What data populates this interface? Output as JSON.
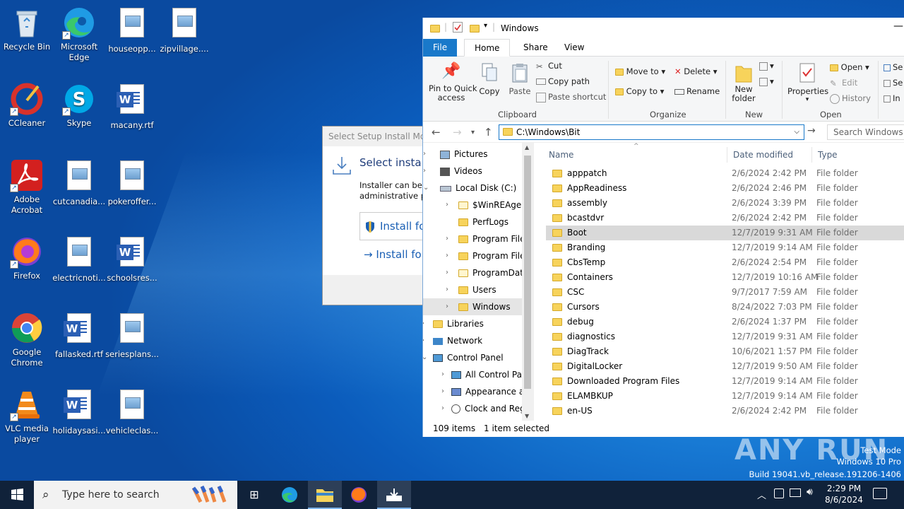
{
  "desktop": {
    "icons": [
      {
        "label": "Recycle Bin"
      },
      {
        "label": "Microsoft Edge"
      },
      {
        "label": "houseopp..."
      },
      {
        "label": "zipvillage...."
      },
      {
        "label": "CCleaner"
      },
      {
        "label": "Skype"
      },
      {
        "label": "macany.rtf"
      },
      {
        "label": "Adobe Acrobat"
      },
      {
        "label": "cutcanadia..."
      },
      {
        "label": "pokeroffer..."
      },
      {
        "label": "Firefox"
      },
      {
        "label": "electricnoti..."
      },
      {
        "label": "schoolsres..."
      },
      {
        "label": "Google Chrome"
      },
      {
        "label": "fallasked.rtf"
      },
      {
        "label": "seriesplans..."
      },
      {
        "label": "VLC media player"
      },
      {
        "label": "holidaysasi..."
      },
      {
        "label": "vehicleclas..."
      }
    ]
  },
  "dialog": {
    "title": "Select Setup Install Mode",
    "heading": "Select install",
    "desc_line1": "Installer can be ir",
    "desc_line2": "administrative pr",
    "option1": "Install fo",
    "option2": "Install fo"
  },
  "explorer": {
    "title": "Windows",
    "tabs": {
      "file": "File",
      "home": "Home",
      "share": "Share",
      "view": "View"
    },
    "ribbon": {
      "pin": "Pin to Quick",
      "pin2": "access",
      "copy": "Copy",
      "paste": "Paste",
      "cut": "Cut",
      "copy_path": "Copy path",
      "paste_shortcut": "Paste shortcut",
      "clipboard": "Clipboard",
      "move_to": "Move to",
      "copy_to": "Copy to",
      "delete": "Delete",
      "rename": "Rename",
      "organize": "Organize",
      "new_folder": "New",
      "new_folder2": "folder",
      "new": "New",
      "properties": "Properties",
      "open": "Open",
      "edit": "Edit",
      "history": "History",
      "open_group": "Open",
      "se1": "Se",
      "se2": "Se",
      "in": "In"
    },
    "address": "C:\\Windows\\Bit",
    "search_placeholder": "Search Windows",
    "tree": [
      {
        "label": "Pictures"
      },
      {
        "label": "Videos"
      },
      {
        "label": "Local Disk (C:)"
      },
      {
        "label": "$WinREAgent"
      },
      {
        "label": "PerfLogs"
      },
      {
        "label": "Program Files"
      },
      {
        "label": "Program Files"
      },
      {
        "label": "ProgramData"
      },
      {
        "label": "Users"
      },
      {
        "label": "Windows"
      },
      {
        "label": "Libraries"
      },
      {
        "label": "Network"
      },
      {
        "label": "Control Panel"
      },
      {
        "label": "All Control Par"
      },
      {
        "label": "Appearance an"
      },
      {
        "label": "Clock and Regi"
      }
    ],
    "columns": {
      "name": "Name",
      "date": "Date modified",
      "type": "Type"
    },
    "files": [
      {
        "name": "apppatch",
        "date": "2/6/2024 2:42 PM",
        "type": "File folder"
      },
      {
        "name": "AppReadiness",
        "date": "2/6/2024 2:46 PM",
        "type": "File folder"
      },
      {
        "name": "assembly",
        "date": "2/6/2024 3:39 PM",
        "type": "File folder"
      },
      {
        "name": "bcastdvr",
        "date": "2/6/2024 2:42 PM",
        "type": "File folder"
      },
      {
        "name": "Boot",
        "date": "12/7/2019 9:31 AM",
        "type": "File folder"
      },
      {
        "name": "Branding",
        "date": "12/7/2019 9:14 AM",
        "type": "File folder"
      },
      {
        "name": "CbsTemp",
        "date": "2/6/2024 2:54 PM",
        "type": "File folder"
      },
      {
        "name": "Containers",
        "date": "12/7/2019 10:16 AM",
        "type": "File folder"
      },
      {
        "name": "CSC",
        "date": "9/7/2017 7:59 AM",
        "type": "File folder"
      },
      {
        "name": "Cursors",
        "date": "8/24/2022 7:03 PM",
        "type": "File folder"
      },
      {
        "name": "debug",
        "date": "2/6/2024 1:37 PM",
        "type": "File folder"
      },
      {
        "name": "diagnostics",
        "date": "12/7/2019 9:31 AM",
        "type": "File folder"
      },
      {
        "name": "DiagTrack",
        "date": "10/6/2021 1:57 PM",
        "type": "File folder"
      },
      {
        "name": "DigitalLocker",
        "date": "12/7/2019 9:50 AM",
        "type": "File folder"
      },
      {
        "name": "Downloaded Program Files",
        "date": "12/7/2019 9:14 AM",
        "type": "File folder"
      },
      {
        "name": "ELAMBKUP",
        "date": "12/7/2019 9:14 AM",
        "type": "File folder"
      },
      {
        "name": "en-US",
        "date": "2/6/2024 2:42 PM",
        "type": "File folder"
      }
    ],
    "status_items": "109 items",
    "status_selected": "1 item selected"
  },
  "watermark": {
    "logo": "ANY RUN",
    "line1": "Test Mode",
    "line2": "Windows 10 Pro",
    "line3": "Build 19041.vb_release.191206-1406"
  },
  "taskbar": {
    "search_placeholder": "Type here to search",
    "time": "2:29 PM",
    "date": "8/6/2024"
  }
}
